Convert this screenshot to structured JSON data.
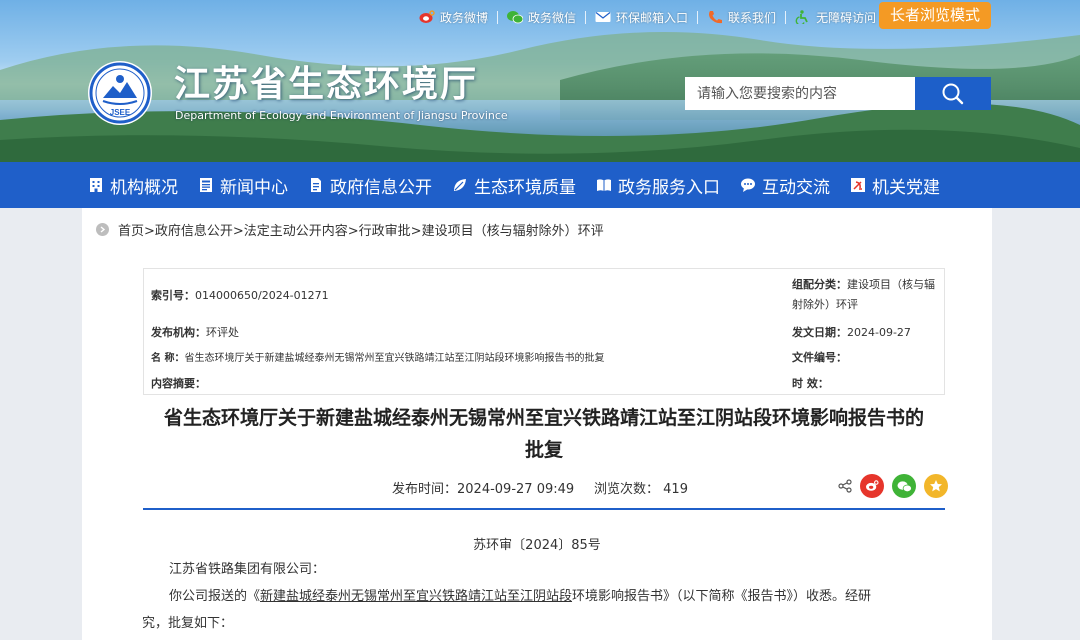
{
  "header": {
    "top_links": [
      {
        "label": "政务微博",
        "icon": "weibo-icon"
      },
      {
        "label": "政务微信",
        "icon": "wechat-icon"
      },
      {
        "label": "环保邮箱入口",
        "icon": "mail-icon"
      },
      {
        "label": "联系我们",
        "icon": "phone-icon"
      },
      {
        "label": "无障碍访问",
        "icon": "accessibility-icon"
      }
    ],
    "elder_mode": "长者浏览模式",
    "site_title": "江苏省生态环境厅",
    "site_subtitle": "Department of Ecology and Environment of Jiangsu Province",
    "logo_text": "JSEE",
    "search_placeholder": "请输入您要搜索的内容"
  },
  "nav": {
    "items": [
      {
        "label": "机构概况",
        "icon": "building-icon"
      },
      {
        "label": "新闻中心",
        "icon": "news-icon"
      },
      {
        "label": "政府信息公开",
        "icon": "document-icon"
      },
      {
        "label": "生态环境质量",
        "icon": "leaf-icon"
      },
      {
        "label": "政务服务入口",
        "icon": "book-icon"
      },
      {
        "label": "互动交流",
        "icon": "chat-icon"
      },
      {
        "label": "机关党建",
        "icon": "party-icon"
      }
    ]
  },
  "breadcrumb": "首页>政府信息公开>法定主动公开内容>行政审批>建设项目（核与辐射除外）环评",
  "meta": {
    "index_label": "索引号：",
    "index_value": "014000650/2024-01271",
    "category_label": "组配分类：",
    "category_value_line1": "建设项目（核与辐",
    "category_value_line2": "射除外）环评",
    "publisher_label": "发布机构：",
    "publisher_value": "环评处",
    "date_label": "发文日期：",
    "date_value": "2024-09-27",
    "name_label": "名 称：",
    "name_value": "省生态环境厅关于新建盐城经泰州无锡常州至宜兴铁路靖江站至江阴站段环境影响报告书的批复",
    "docnum_label": "文件编号：",
    "docnum_value": "",
    "summary_label": "内容摘要：",
    "summary_value": "",
    "validity_label": "时 效：",
    "validity_value": ""
  },
  "article": {
    "title_line1": "省生态环境厅关于新建盐城经泰州无锡常州至宜兴铁路靖江站至江阴站段环境影响报告书的",
    "title_line2": "批复",
    "publish_time_label": "发布时间：",
    "publish_time": "2024-09-27 09:49",
    "views_label": "浏览次数：",
    "views": "419",
    "doc_number": "苏环审〔2024〕85号",
    "salutation": "江苏省铁路集团有限公司：",
    "para1_prefix": "你公司报送的《",
    "para1_link": "新建盐城经泰州无锡常州至宜兴铁路靖江站至江阴站段",
    "para1_mid": "环境影响报告书》（以下简称《报告书》）收悉。经研",
    "para1_line2": "究，批复如下："
  },
  "colors": {
    "nav_bg": "#1f5fc9",
    "elder_btn": "#f49a24",
    "share_weibo": "#e6352b",
    "share_wechat": "#3fb337",
    "share_fav": "#f2b62a"
  }
}
